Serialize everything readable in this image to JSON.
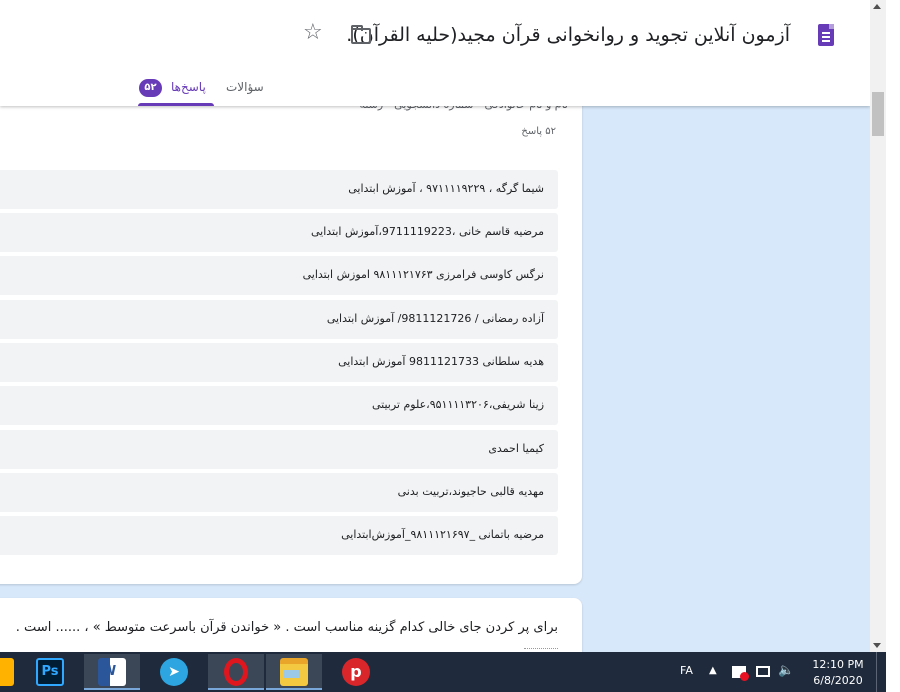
{
  "header": {
    "title": "آزمون آنلاین تجوید و روانخوانی قرآن مجید(حلیه القرآن).",
    "tabs": {
      "questions": "سؤالات",
      "responses": "پاسخ‌ها",
      "responses_count": "۵۲"
    }
  },
  "question1": {
    "partial_title": "نام و نام خانوادگی - شماره دانشجویی - رشته",
    "response_count_label": "۵۲ پاسخ",
    "responses": [
      "شیما گرگه ، ۹۷۱۱۱۱۹۲۲۹ ، آموزش ابتدایی",
      "مرضیه قاسم خانی ،9711119223،آموزش ابتدایی",
      "نرگس کاوسی فرامرزی ۹۸۱۱۱۲۱۷۶۳ اموزش ابتدایی",
      "آزاده رمضانی / 9811121726/ آموزش ابتدایی",
      "هدیه سلطانی 9811121733 آموزش ابتدایی",
      "زینا شریفی،۹۵۱۱۱۱۳۲۰۶،علوم تربیتی",
      "کیمیا احمدی",
      "مهدیه قالبی حاجیوند،تربیت بدنی",
      "مرضیه باتمانی _۹۸۱۱۱۲۱۶۹۷_آموزش‌ابتدایی"
    ]
  },
  "question2": {
    "text": "برای پر کردن جای خالی کدام گزینه مناسب است . « خواندن قرآن باسرعت متوسط » ، ...... است ."
  },
  "taskbar": {
    "apps": [
      {
        "name": "photoshop",
        "label": "Ps"
      },
      {
        "name": "word",
        "label": "W"
      },
      {
        "name": "telegram",
        "label": "➤"
      },
      {
        "name": "opera",
        "label": ""
      },
      {
        "name": "file-explorer",
        "label": ""
      },
      {
        "name": "psiphon",
        "label": "p"
      }
    ],
    "tray": {
      "language": "FA",
      "time": "12:10 PM",
      "date": "6/8/2020"
    }
  },
  "colors": {
    "accent": "#673ab7",
    "page_background": "#d7e8fa",
    "taskbar": "#1f2b3c"
  }
}
